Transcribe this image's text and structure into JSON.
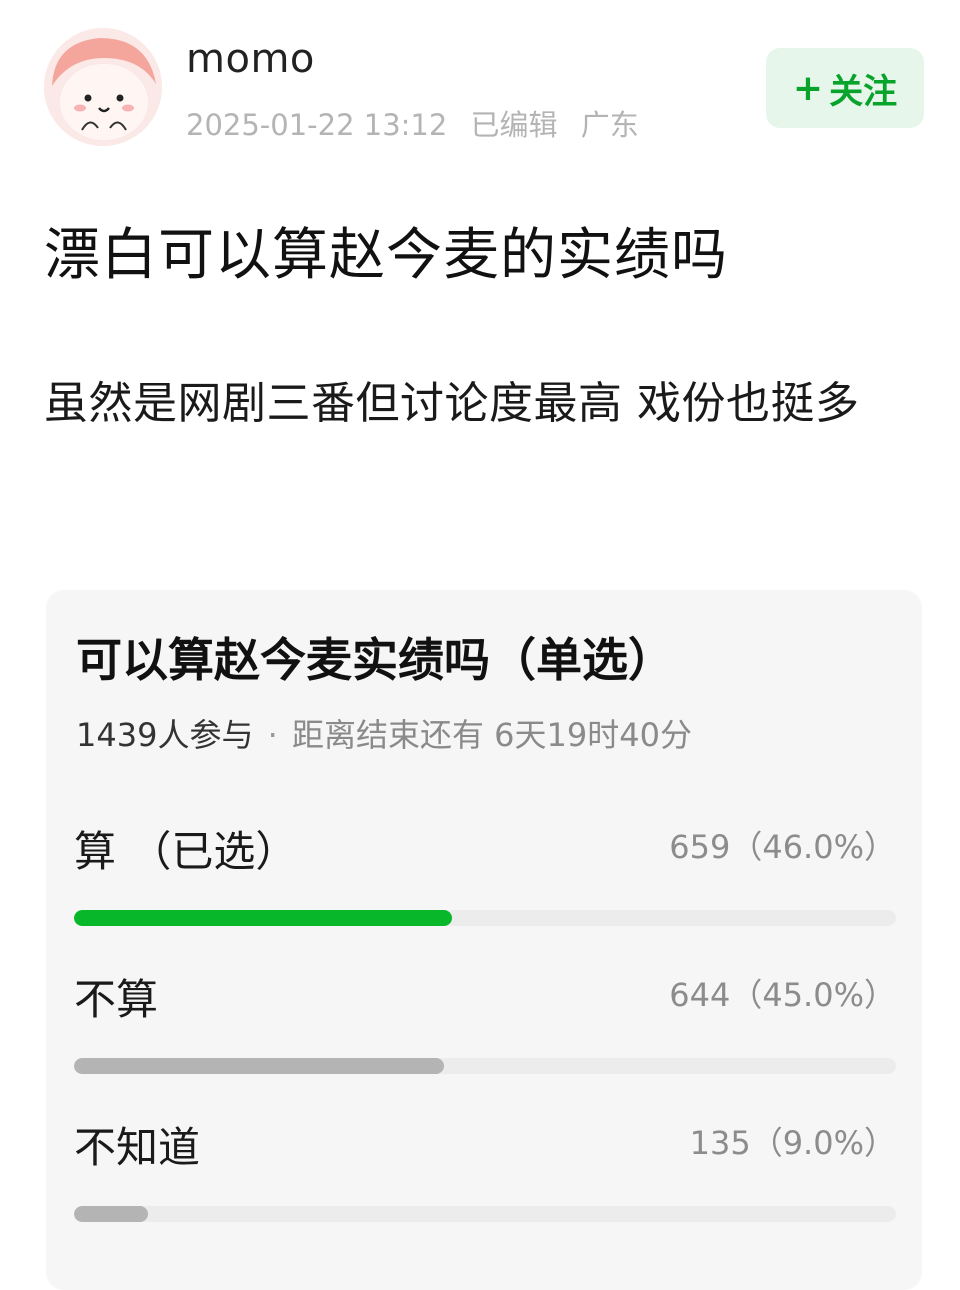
{
  "colors": {
    "selected_bar": "#09b82a",
    "unselected_bar": "#b4b4b4",
    "follow_text": "#07a32b",
    "follow_bg": "#e7f6ea"
  },
  "author": {
    "name": "momo",
    "avatar_icon": "cartoon-face-avatar",
    "timestamp": "2025-01-22 13:12",
    "edited": "已编辑",
    "location": "广东"
  },
  "follow_button": {
    "icon": "plus-icon",
    "icon_glyph": "+",
    "label": "关注"
  },
  "post": {
    "title": "漂白可以算赵今麦的实绩吗",
    "body": "虽然是网剧三番但讨论度最高 戏份也挺多"
  },
  "poll": {
    "title": "可以算赵今麦实绩吗（单选）",
    "participants": "1439人参与",
    "separator": "·",
    "remaining": "距离结束还有 6天19时40分",
    "options": [
      {
        "label": "算 （已选）",
        "count_text": "659（46.0%）",
        "fraction": 0.46,
        "selected": true
      },
      {
        "label": "不算",
        "count_text": "644（45.0%）",
        "fraction": 0.45,
        "selected": false
      },
      {
        "label": "不知道",
        "count_text": "135（9.0%）",
        "fraction": 0.09,
        "selected": false
      }
    ]
  }
}
